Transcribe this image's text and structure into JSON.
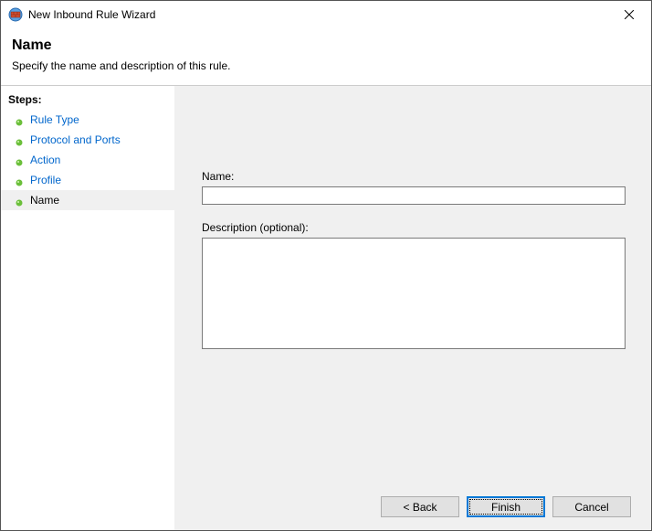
{
  "window": {
    "title": "New Inbound Rule Wizard"
  },
  "header": {
    "title": "Name",
    "subtitle": "Specify the name and description of this rule."
  },
  "sidebar": {
    "title": "Steps:",
    "items": [
      {
        "label": "Rule Type"
      },
      {
        "label": "Protocol and Ports"
      },
      {
        "label": "Action"
      },
      {
        "label": "Profile"
      },
      {
        "label": "Name"
      }
    ]
  },
  "form": {
    "name_label": "Name:",
    "name_value": "",
    "description_label": "Description (optional):",
    "description_value": ""
  },
  "buttons": {
    "back": "< Back",
    "finish": "Finish",
    "cancel": "Cancel"
  }
}
